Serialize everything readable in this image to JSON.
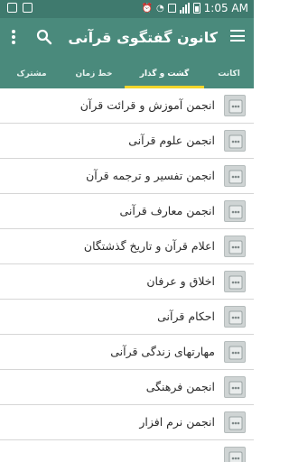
{
  "status_bar": {
    "time": "1:05 AM",
    "battery": "1"
  },
  "app_bar": {
    "title": "کانون گفتگوی قرآنی"
  },
  "tabs": [
    {
      "label": "اکانت"
    },
    {
      "label": "گشت و گذار"
    },
    {
      "label": "خط زمان"
    },
    {
      "label": "مشترک"
    }
  ],
  "list": {
    "items": [
      {
        "label": "انجمن آموزش و قرائت قرآن"
      },
      {
        "label": "انجمن علوم قرآنی"
      },
      {
        "label": "انجمن تفسیر و ترجمه قرآن"
      },
      {
        "label": "انجمن معارف قرآنی"
      },
      {
        "label": "اعلام قرآن و تاریخ گذشتگان"
      },
      {
        "label": "اخلاق و عرفان"
      },
      {
        "label": "احکام قرآنی"
      },
      {
        "label": "مهارتهای زندگی قرآنی"
      },
      {
        "label": "انجمن فرهنگی"
      },
      {
        "label": "انجمن نرم افزار"
      }
    ]
  },
  "colors": {
    "primary": "#4a8a7c",
    "status_bar": "#3f7a6e",
    "tab_indicator": "#f2d52b"
  }
}
